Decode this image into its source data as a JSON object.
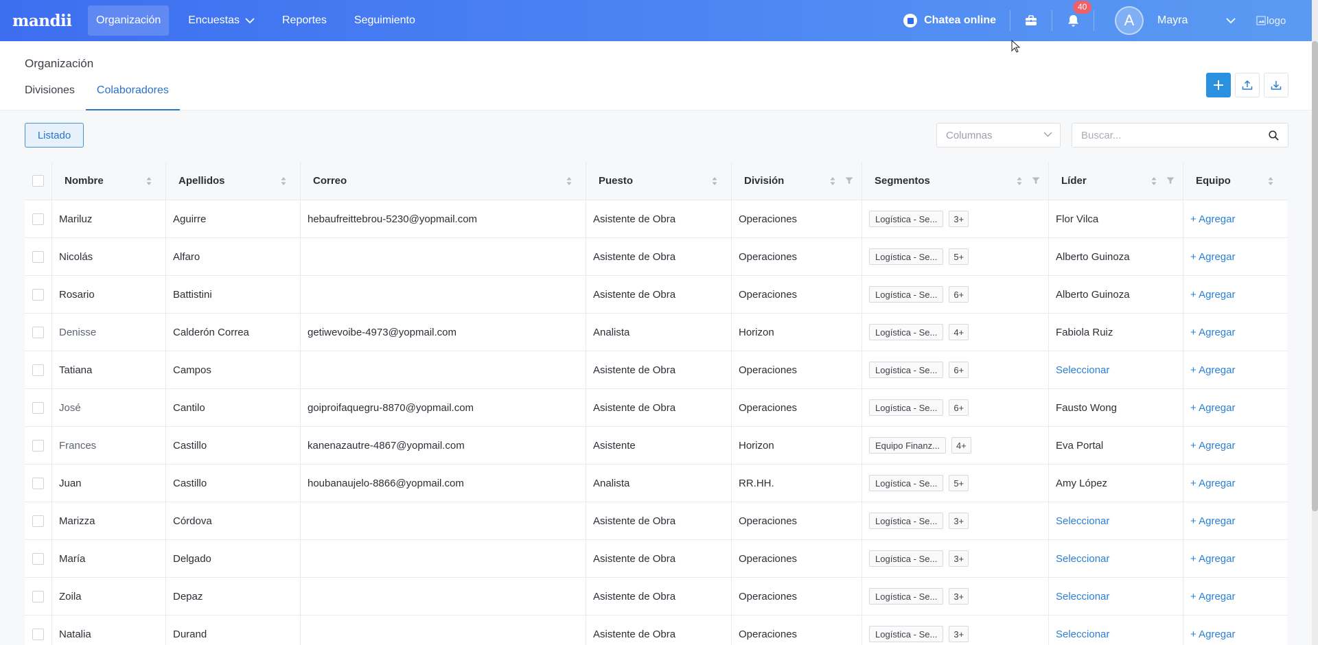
{
  "topbar": {
    "brand": "mandii",
    "nav": [
      {
        "label": "Organización",
        "active": true
      },
      {
        "label": "Encuestas",
        "dropdown": true
      },
      {
        "label": "Reportes"
      },
      {
        "label": "Seguimiento"
      }
    ],
    "chat_label": "Chatea online",
    "notifications_count": "40",
    "avatar_initial": "A",
    "user_name": "Mayra",
    "logo_alt": "logo"
  },
  "page": {
    "title": "Organización",
    "tabs": [
      {
        "label": "Divisiones"
      },
      {
        "label": "Colaboradores",
        "active": true
      }
    ]
  },
  "toolbar": {
    "listado_label": "Listado",
    "columns_placeholder": "Columnas",
    "search_placeholder": "Buscar..."
  },
  "table": {
    "headers": {
      "nombre": "Nombre",
      "apellidos": "Apellidos",
      "correo": "Correo",
      "puesto": "Puesto",
      "division": "División",
      "segmentos": "Segmentos",
      "lider": "Líder",
      "equipo": "Equipo"
    },
    "rows": [
      {
        "nombre": "Mariluz",
        "apellidos": "Aguirre",
        "correo": "hebaufreittebrou-5230@yopmail.com",
        "puesto": "Asistente de Obra",
        "division": "Operaciones",
        "segmento": "Logística - Se...",
        "segmento_mas": "3+",
        "lider": "Flor Vilca",
        "equipo": "+ Agregar"
      },
      {
        "nombre": "Nicolás",
        "apellidos": "Alfaro",
        "correo": "",
        "puesto": "Asistente de Obra",
        "division": "Operaciones",
        "segmento": "Logística - Se...",
        "segmento_mas": "5+",
        "lider": "Alberto Guinoza",
        "equipo": "+ Agregar"
      },
      {
        "nombre": "Rosario",
        "apellidos": "Battistini",
        "correo": "",
        "puesto": "Asistente de Obra",
        "division": "Operaciones",
        "segmento": "Logística - Se...",
        "segmento_mas": "6+",
        "lider": "Alberto Guinoza",
        "equipo": "+ Agregar"
      },
      {
        "nombre": "Denisse",
        "apellidos": "Calderón Correa",
        "correo": "getiwevoibe-4973@yopmail.com",
        "puesto": "Analista",
        "division": "Horizon",
        "segmento": "Logística - Se...",
        "segmento_mas": "4+",
        "lider": "Fabiola Ruiz",
        "equipo": "+ Agregar"
      },
      {
        "nombre": "Tatiana",
        "apellidos": "Campos",
        "correo": "",
        "puesto": "Asistente de Obra",
        "division": "Operaciones",
        "segmento": "Logística - Se...",
        "segmento_mas": "6+",
        "lider": "Seleccionar",
        "equipo": "+ Agregar"
      },
      {
        "nombre": "José",
        "apellidos": "Cantilo",
        "correo": "goiproifaquegru-8870@yopmail.com",
        "puesto": "Asistente de Obra",
        "division": "Operaciones",
        "segmento": "Logística - Se...",
        "segmento_mas": "6+",
        "lider": "Fausto Wong",
        "equipo": "+ Agregar"
      },
      {
        "nombre": "Frances",
        "apellidos": "Castillo",
        "correo": "kanenazautre-4867@yopmail.com",
        "puesto": "Asistente",
        "division": "Horizon",
        "segmento": "Equipo Finanz...",
        "segmento_mas": "4+",
        "lider": "Eva Portal",
        "equipo": "+ Agregar"
      },
      {
        "nombre": "Juan",
        "apellidos": "Castillo",
        "correo": "houbanaujelo-8866@yopmail.com",
        "puesto": "Analista",
        "division": "RR.HH.",
        "segmento": "Logística - Se...",
        "segmento_mas": "5+",
        "lider": "Amy López",
        "equipo": "+ Agregar"
      },
      {
        "nombre": "Marizza",
        "apellidos": "Córdova",
        "correo": "",
        "puesto": "Asistente de Obra",
        "division": "Operaciones",
        "segmento": "Logística - Se...",
        "segmento_mas": "3+",
        "lider": "Seleccionar",
        "equipo": "+ Agregar"
      },
      {
        "nombre": "María",
        "apellidos": "Delgado",
        "correo": "",
        "puesto": "Asistente de Obra",
        "division": "Operaciones",
        "segmento": "Logística - Se...",
        "segmento_mas": "3+",
        "lider": "Seleccionar",
        "equipo": "+ Agregar"
      },
      {
        "nombre": "Zoila",
        "apellidos": "Depaz",
        "correo": "",
        "puesto": "Asistente de Obra",
        "division": "Operaciones",
        "segmento": "Logística - Se...",
        "segmento_mas": "3+",
        "lider": "Seleccionar",
        "equipo": "+ Agregar"
      },
      {
        "nombre": "Natalia",
        "apellidos": "Durand",
        "correo": "",
        "puesto": "Asistente de Obra",
        "division": "Operaciones",
        "segmento": "Logística - Se...",
        "segmento_mas": "3+",
        "lider": "Seleccionar",
        "equipo": "+ Agregar"
      }
    ]
  },
  "icons": {
    "chevron": "chevron-down-icon",
    "gift": "briefcase-icon",
    "bell": "bell-icon",
    "plus": "plus-icon",
    "upload": "upload-icon",
    "download": "download-icon",
    "search": "search-icon",
    "sort": "sort-icon",
    "filter": "filter-icon"
  },
  "colors": {
    "topbar_start": "#3d6ef0",
    "topbar_end": "#5b9bf2",
    "accent": "#2a73c7",
    "primary_button": "#2a90e0",
    "link": "#2a7fd4",
    "badge": "#f0606a"
  }
}
